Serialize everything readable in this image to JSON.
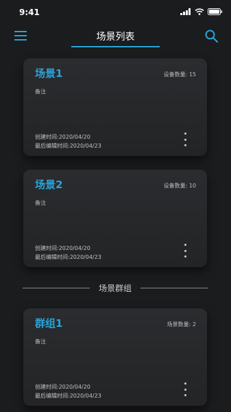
{
  "status_bar": {
    "time": "9:41"
  },
  "nav": {
    "title": "场景列表"
  },
  "scenes": [
    {
      "title": "场景1",
      "count": "设备数量: 15",
      "note": "备注",
      "created": "创建时间:2020/04/20",
      "edited": "最后编辑时间:2020/04/23"
    },
    {
      "title": "场景2",
      "count": "设备数量: 10",
      "note": "备注",
      "created": "创建时间:2020/04/20",
      "edited": "最后编辑时间:2020/04/23"
    }
  ],
  "section": {
    "label": "场景群组"
  },
  "groups": [
    {
      "title": "群组1",
      "count": "场景数量: 2",
      "note": "备注",
      "created": "创建时间:2020/04/20",
      "edited": "最后编辑时间:2020/04/23"
    }
  ],
  "colors": {
    "accent": "#2aa3d8",
    "background": "#1b1c1e",
    "card": "#2b2c2f"
  },
  "icons": {
    "menu": "menu-icon",
    "search": "search-icon",
    "more": "more-vertical-icon",
    "signal": "signal-icon",
    "wifi": "wifi-icon",
    "battery": "battery-icon"
  }
}
